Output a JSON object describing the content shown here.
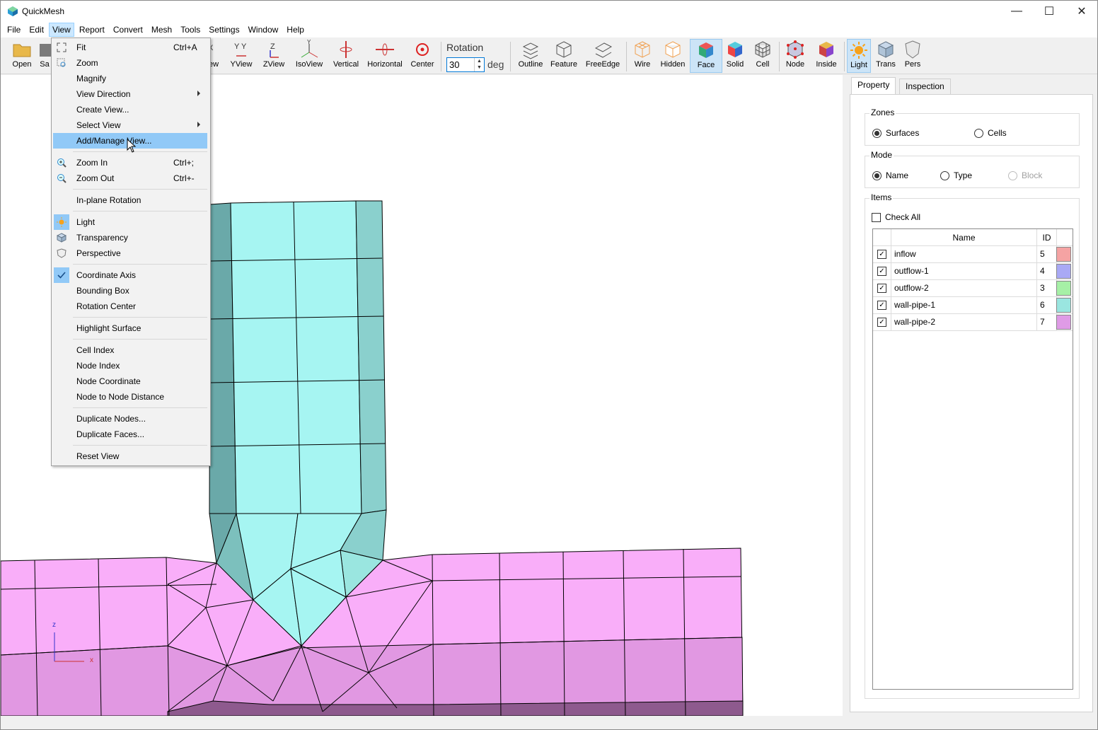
{
  "window": {
    "title": "QuickMesh"
  },
  "titlebar_buttons": {
    "minimize": "—",
    "maximize": "☐",
    "close": "✕"
  },
  "menubar": [
    "File",
    "Edit",
    "View",
    "Report",
    "Convert",
    "Mesh",
    "Tools",
    "Settings",
    "Window",
    "Help"
  ],
  "toolbar": {
    "open": "Open",
    "save": "Sa",
    "xview": "ew",
    "yview": "YView",
    "zview": "ZView",
    "isoview": "IsoView",
    "vertical": "Vertical",
    "horizontal": "Horizontal",
    "center": "Center",
    "rotation_label": "Rotation",
    "rotation_value": "30",
    "rotation_unit": "deg",
    "outline": "Outline",
    "feature": "Feature",
    "freeedge": "FreeEdge",
    "wire": "Wire",
    "hidden": "Hidden",
    "face": "Face",
    "solid": "Solid",
    "cell": "Cell",
    "node": "Node",
    "inside": "Inside",
    "light": "Light",
    "trans": "Trans",
    "pers": "Pers"
  },
  "view_menu": {
    "fit": "Fit",
    "fit_sc": "Ctrl+A",
    "zoom": "Zoom",
    "magnify": "Magnify",
    "view_direction": "View Direction",
    "create_view": "Create View...",
    "select_view": "Select View",
    "add_manage_view": "Add/Manage View...",
    "zoom_in": "Zoom In",
    "zoom_in_sc": "Ctrl+;",
    "zoom_out": "Zoom Out",
    "zoom_out_sc": "Ctrl+-",
    "inplane_rotation": "In-plane Rotation",
    "light": "Light",
    "transparency": "Transparency",
    "perspective": "Perspective",
    "coordinate_axis": "Coordinate Axis",
    "bounding_box": "Bounding Box",
    "rotation_center": "Rotation Center",
    "highlight_surface": "Highlight Surface",
    "cell_index": "Cell Index",
    "node_index": "Node Index",
    "node_coordinate": "Node Coordinate",
    "node_to_node_distance": "Node to Node Distance",
    "duplicate_nodes": "Duplicate Nodes...",
    "duplicate_faces": "Duplicate Faces...",
    "reset_view": "Reset View"
  },
  "panel": {
    "tabs": [
      "Property",
      "Inspection"
    ],
    "zones_title": "Zones",
    "zones_surfaces": "Surfaces",
    "zones_cells": "Cells",
    "mode_title": "Mode",
    "mode_name": "Name",
    "mode_type": "Type",
    "mode_block": "Block",
    "items_title": "Items",
    "check_all": "Check All",
    "col_name": "Name",
    "col_id": "ID",
    "rows": [
      {
        "name": "inflow",
        "id": "5",
        "color": "#f5a3a3"
      },
      {
        "name": "outflow-1",
        "id": "4",
        "color": "#a9a9f5"
      },
      {
        "name": "outflow-2",
        "id": "3",
        "color": "#a6f0a6"
      },
      {
        "name": "wall-pipe-1",
        "id": "6",
        "color": "#9ae6e0"
      },
      {
        "name": "wall-pipe-2",
        "id": "7",
        "color": "#df9be6"
      }
    ]
  },
  "axis": {
    "z": "z",
    "x": "x"
  },
  "colors": {
    "pipe1": "#a6f5f2",
    "pipe2": "#f9aef9",
    "accent": "#0078d7"
  }
}
